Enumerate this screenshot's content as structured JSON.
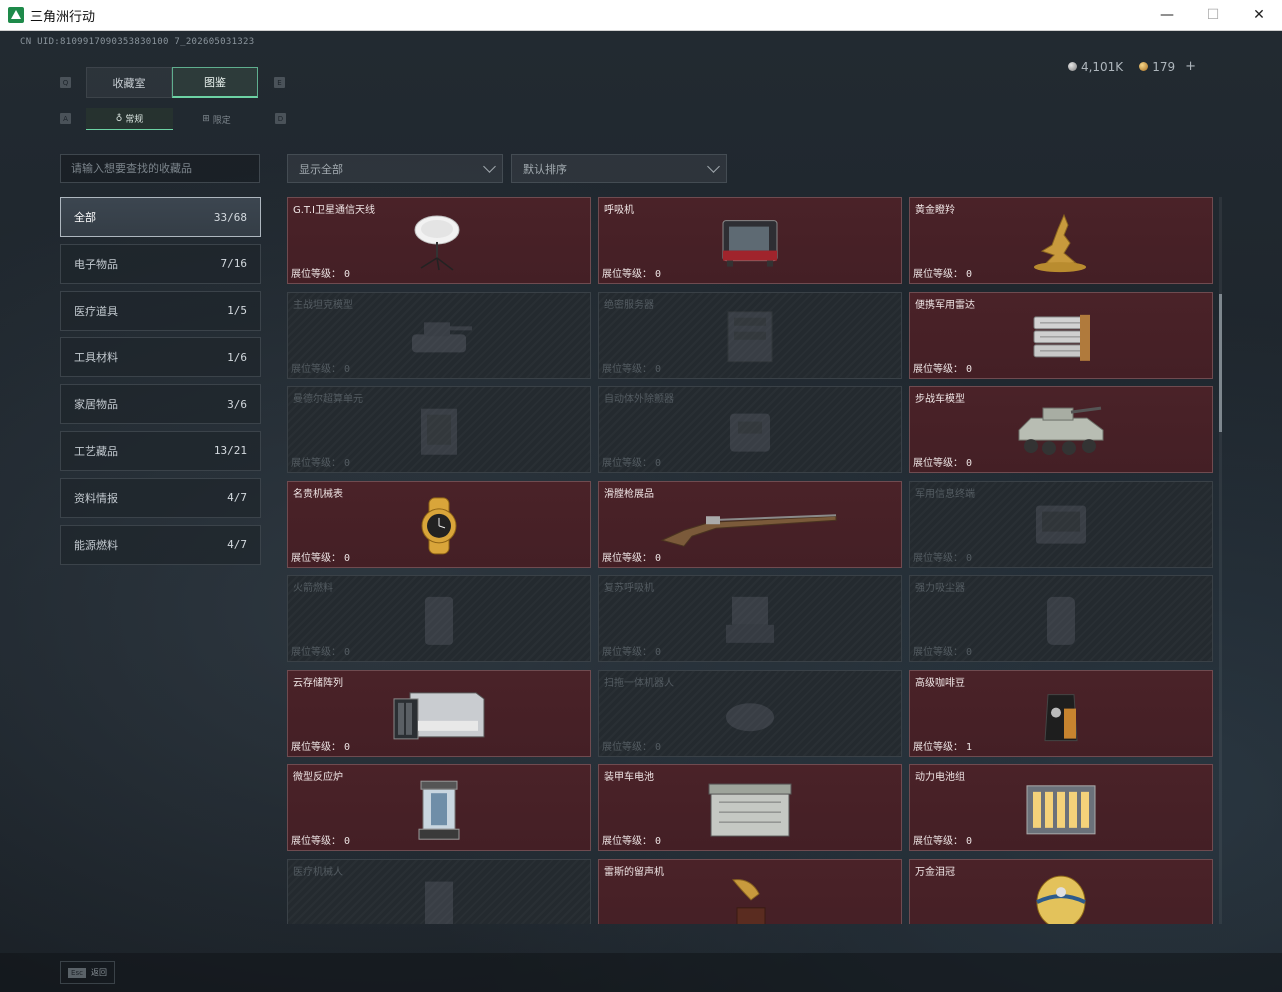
{
  "window": {
    "title": "三角洲行动",
    "minimize": "—",
    "maximize": "☐",
    "close": "✕"
  },
  "header": {
    "uid": "CN UID:8109917090353830100 7_202605031323",
    "silver": "4,101K",
    "gold": "179",
    "plus": "+"
  },
  "tabs": {
    "key_left": "Q",
    "key_right": "E",
    "collection_room": "收藏室",
    "catalog": "图鉴",
    "key_sub_left": "A",
    "key_sub_right": "D",
    "regular": "常规",
    "limited": "限定"
  },
  "search": {
    "placeholder": "请输入想要查找的收藏品"
  },
  "filters": {
    "show": "显示全部",
    "sort": "默认排序"
  },
  "categories": [
    {
      "label": "全部",
      "count": "33/68"
    },
    {
      "label": "电子物品",
      "count": "7/16"
    },
    {
      "label": "医疗道具",
      "count": "1/5"
    },
    {
      "label": "工具材料",
      "count": "1/6"
    },
    {
      "label": "家居物品",
      "count": "3/6"
    },
    {
      "label": "工艺藏品",
      "count": "13/21"
    },
    {
      "label": "资料情报",
      "count": "4/7"
    },
    {
      "label": "能源燃料",
      "count": "4/7"
    }
  ],
  "level_label": "展位等级：",
  "items": [
    {
      "name": "G.T.I卫星通信天线",
      "level": "0",
      "icon": "satellite-dish-icon"
    },
    {
      "name": "呼吸机",
      "level": "0",
      "icon": "ventilator-icon"
    },
    {
      "name": "黄金瞪羚",
      "level": "0",
      "icon": "golden-gazelle-icon"
    },
    {
      "name": "主战坦克模型",
      "level": "0",
      "icon": "tank-model-icon"
    },
    {
      "name": "绝密服务器",
      "level": "0",
      "icon": "server-icon"
    },
    {
      "name": "便携军用雷达",
      "level": "0",
      "icon": "radar-icon"
    },
    {
      "name": "曼德尔超算单元",
      "level": "0",
      "icon": "supercomputer-icon"
    },
    {
      "name": "自动体外除颤器",
      "level": "0",
      "icon": "defibrillator-icon"
    },
    {
      "name": "步战车模型",
      "level": "0",
      "icon": "ifv-model-icon"
    },
    {
      "name": "名贵机械表",
      "level": "0",
      "icon": "watch-icon"
    },
    {
      "name": "滑膛枪展品",
      "level": "0",
      "icon": "musket-icon"
    },
    {
      "name": "军用信息终端",
      "level": "0",
      "icon": "terminal-icon"
    },
    {
      "name": "火箭燃料",
      "level": "0",
      "icon": "rocket-fuel-icon"
    },
    {
      "name": "复苏呼吸机",
      "level": "0",
      "icon": "resuscitator-icon"
    },
    {
      "name": "强力吸尘器",
      "level": "0",
      "icon": "vacuum-icon"
    },
    {
      "name": "云存储阵列",
      "level": "0",
      "icon": "storage-array-icon"
    },
    {
      "name": "扫拖一体机器人",
      "level": "0",
      "icon": "robot-vacuum-icon"
    },
    {
      "name": "高级咖啡豆",
      "level": "1",
      "icon": "coffee-bag-icon"
    },
    {
      "name": "微型反应炉",
      "level": "0",
      "icon": "reactor-icon"
    },
    {
      "name": "装甲车电池",
      "level": "0",
      "icon": "vehicle-battery-icon"
    },
    {
      "name": "动力电池组",
      "level": "0",
      "icon": "battery-pack-icon"
    },
    {
      "name": "医疗机械人",
      "level": "",
      "icon": "medical-robot-icon"
    },
    {
      "name": "雷斯的留声机",
      "level": "",
      "icon": "gramophone-icon"
    },
    {
      "name": "万金泪冠",
      "level": "",
      "icon": "jeweled-egg-icon"
    }
  ],
  "footer": {
    "esc": "Esc",
    "back": "返回"
  },
  "colors": {
    "accent": "#6dd3a4",
    "owned": "#4a2228",
    "locked": "#242a2f"
  }
}
